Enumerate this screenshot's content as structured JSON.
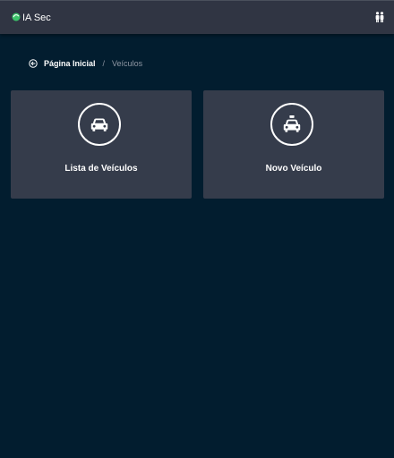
{
  "app": {
    "title": "IA Sec",
    "logo_icon": "app-logo-icon",
    "logo_color": "#3cc46a"
  },
  "header": {
    "users_icon": "users-icon"
  },
  "breadcrumb": {
    "back_icon": "arrow-left-circle-icon",
    "home": "Página Inicial",
    "separator": "/",
    "current": "Veículos"
  },
  "cards": [
    {
      "label": "Lista de Veículos",
      "icon": "car-icon"
    },
    {
      "label": "Novo Veículo",
      "icon": "taxi-icon"
    }
  ],
  "colors": {
    "background": "#021d2f",
    "header": "#303543",
    "card": "#353c4b",
    "muted_text": "#8f98a4"
  }
}
